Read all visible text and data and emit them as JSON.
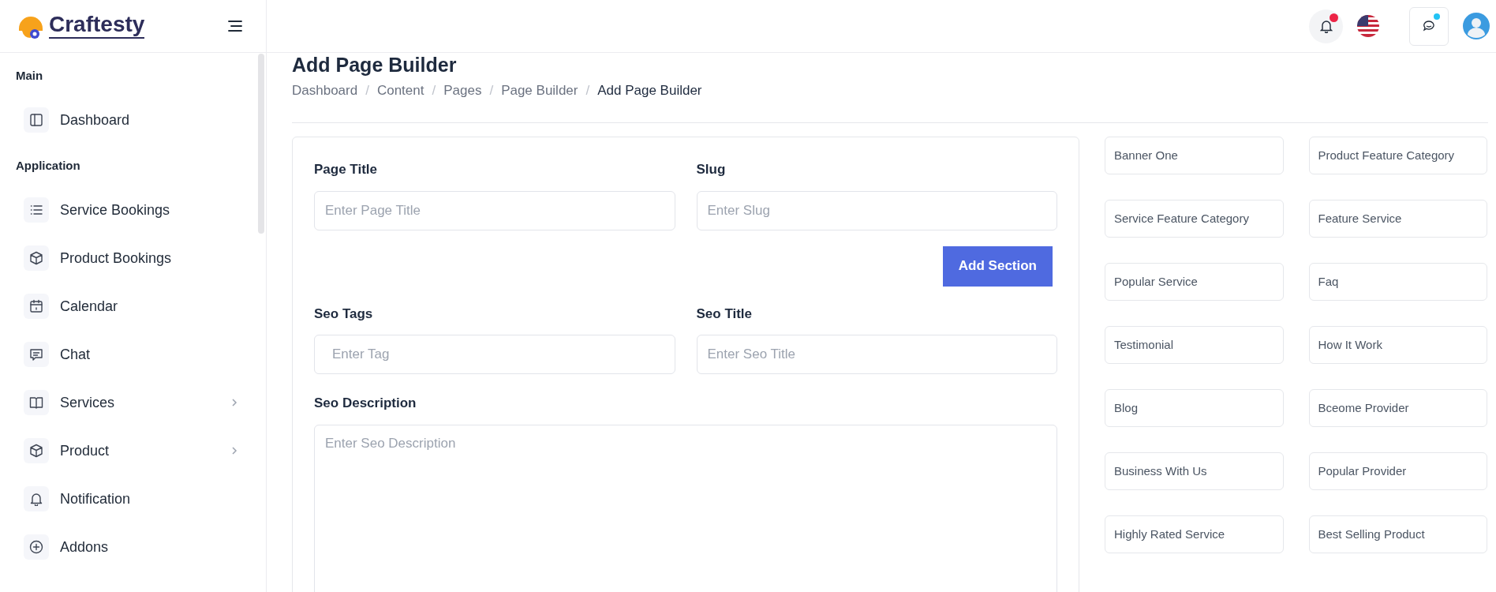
{
  "brand": {
    "name": "Craftesty"
  },
  "sidebar": {
    "sections": [
      {
        "title": "Main",
        "items": [
          {
            "label": "Dashboard",
            "has_submenu": false
          }
        ]
      },
      {
        "title": "Application",
        "items": [
          {
            "label": "Service Bookings",
            "has_submenu": false
          },
          {
            "label": "Product Bookings",
            "has_submenu": false
          },
          {
            "label": "Calendar",
            "has_submenu": false
          },
          {
            "label": "Chat",
            "has_submenu": false
          },
          {
            "label": "Services",
            "has_submenu": true
          },
          {
            "label": "Product",
            "has_submenu": true
          },
          {
            "label": "Notification",
            "has_submenu": false
          },
          {
            "label": "Addons",
            "has_submenu": false
          }
        ]
      }
    ]
  },
  "header": {
    "notification_unread": true,
    "messages_unread": true
  },
  "page": {
    "title": "Add Page Builder",
    "breadcrumb_separator": "/",
    "breadcrumb": [
      {
        "label": "Dashboard",
        "current": false
      },
      {
        "label": "Content",
        "current": false
      },
      {
        "label": "Pages",
        "current": false
      },
      {
        "label": "Page Builder",
        "current": false
      },
      {
        "label": "Add Page Builder",
        "current": true
      }
    ]
  },
  "form": {
    "page_title": {
      "label": "Page Title",
      "placeholder": "Enter Page Title"
    },
    "slug": {
      "label": "Slug",
      "placeholder": "Enter Slug"
    },
    "add_section_button": "Add Section",
    "seo_tags": {
      "label": "Seo Tags",
      "placeholder": "Enter Tag"
    },
    "seo_title": {
      "label": "Seo Title",
      "placeholder": "Enter Seo Title"
    },
    "seo_description": {
      "label": "Seo Description",
      "placeholder": "Enter Seo Description"
    }
  },
  "sections": [
    "Banner One",
    "Product Feature Category",
    "Service Feature Category",
    "Feature Service",
    "Popular Service",
    "Faq",
    "Testimonial",
    "How It Work",
    "Blog",
    "Bceome Provider",
    "Business With Us",
    "Popular Provider",
    "Highly Rated Service",
    "Best Selling Product"
  ]
}
